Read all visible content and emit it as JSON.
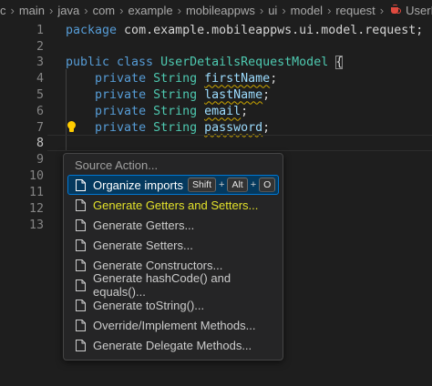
{
  "breadcrumb": {
    "items": [
      "c",
      "main",
      "java",
      "com",
      "example",
      "mobileappws",
      "ui",
      "model",
      "request"
    ],
    "file": "UserDe"
  },
  "editor": {
    "lines": [
      {
        "n": "1",
        "text": [
          "package com.example.mobileappws.ui.model.request;"
        ]
      },
      {
        "n": "2",
        "text": [
          ""
        ]
      },
      {
        "n": "3",
        "kw": "public class ",
        "ty": "UserDetailsRequestModel ",
        "brace": "{"
      },
      {
        "n": "4",
        "kw": "private ",
        "ty": "String ",
        "var": "firstName",
        "end": ";"
      },
      {
        "n": "5",
        "kw": "private ",
        "ty": "String ",
        "var": "lastName",
        "end": ";"
      },
      {
        "n": "6",
        "kw": "private ",
        "ty": "String ",
        "var": "email",
        "end": ";"
      },
      {
        "n": "7",
        "kw": "private ",
        "ty": "String ",
        "var": "password",
        "end": ";"
      },
      {
        "n": "8"
      },
      {
        "n": "9"
      },
      {
        "n": "10"
      },
      {
        "n": "11"
      },
      {
        "n": "12"
      },
      {
        "n": "13"
      }
    ]
  },
  "menu": {
    "header": "Source Action...",
    "items": [
      {
        "label": "Organize imports",
        "keys": [
          "Shift",
          "Alt",
          "O"
        ]
      },
      {
        "label": "Generate Getters and Setters..."
      },
      {
        "label": "Generate Getters..."
      },
      {
        "label": "Generate Setters..."
      },
      {
        "label": "Generate Constructors..."
      },
      {
        "label": "Generate hashCode() and equals()..."
      },
      {
        "label": "Generate toString()..."
      },
      {
        "label": "Override/Implement Methods..."
      },
      {
        "label": "Generate Delegate Methods..."
      }
    ]
  },
  "colors": {
    "keyword": "#569cd6",
    "type": "#4ec9b0",
    "variable": "#9cdcfe",
    "highlight": "#e3e22a",
    "selection": "#04395e"
  }
}
